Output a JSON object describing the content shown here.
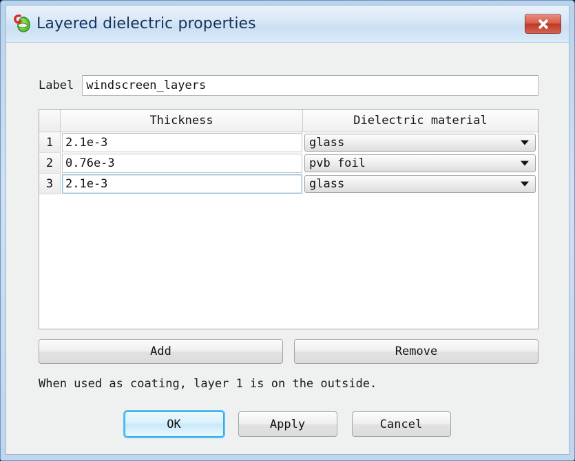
{
  "window": {
    "title": "Layered dielectric properties",
    "icon": "app-leaf-icon",
    "close_label": "x",
    "accent_color": "#16325c",
    "titlebar_color": "#cbe0f3",
    "close_color": "#bf3a26",
    "default_button_glow": "#4fc3f7"
  },
  "label_field": {
    "caption": "Label",
    "value": "windscreen_layers",
    "placeholder": ""
  },
  "table": {
    "columns": [
      "",
      "Thickness",
      "Dielectric material"
    ],
    "rows": [
      {
        "index": "1",
        "thickness": "2.1e-3",
        "material": "glass",
        "focused": false
      },
      {
        "index": "2",
        "thickness": "0.76e-3",
        "material": "pvb foil",
        "focused": false
      },
      {
        "index": "3",
        "thickness": "2.1e-3",
        "material": "glass",
        "focused": true
      }
    ],
    "material_options": [
      "glass",
      "pvb foil"
    ]
  },
  "actions": {
    "add_label": "Add",
    "remove_label": "Remove"
  },
  "hint": "When used as coating, layer 1 is on the outside.",
  "footer": {
    "ok_label": "OK",
    "apply_label": "Apply",
    "cancel_label": "Cancel"
  }
}
